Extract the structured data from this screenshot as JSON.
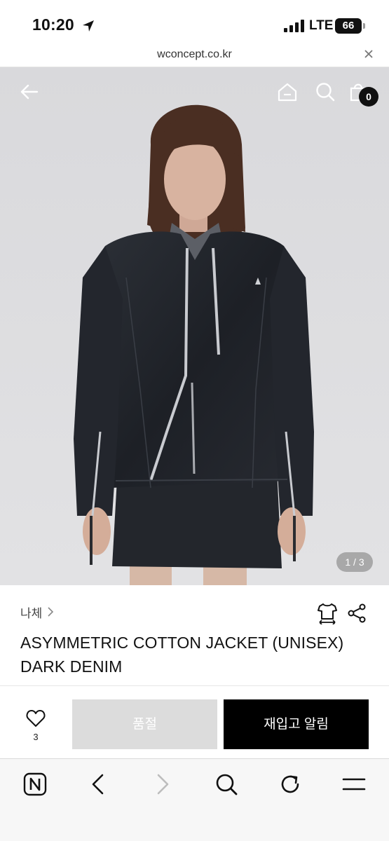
{
  "status_bar": {
    "time": "10:20",
    "network": "LTE",
    "battery": "66"
  },
  "browser": {
    "url": "wconcept.co.kr"
  },
  "header": {
    "cart_count": "0"
  },
  "gallery": {
    "page_indicator": "1 / 3",
    "current": 1,
    "total": 3
  },
  "product": {
    "brand": "나체",
    "title_line1": "ASYMMETRIC COTTON JACKET (UNISEX)",
    "title_line2": "DARK DENIM"
  },
  "actions": {
    "wish_count": "3",
    "soldout_label": "품절",
    "restock_label": "재입고 알림"
  },
  "colors": {
    "soldout_bg": "#dcdcdc",
    "restock_bg": "#000000",
    "hero_bg": "#dcdcdf"
  },
  "icons": {
    "header": [
      "back-arrow-icon",
      "home-icon",
      "search-icon",
      "cart-icon"
    ],
    "product": [
      "size-guide-icon",
      "share-icon"
    ],
    "toolbar": [
      "naver-icon",
      "back-icon",
      "forward-icon",
      "search-icon",
      "refresh-icon",
      "menu-icon"
    ]
  }
}
